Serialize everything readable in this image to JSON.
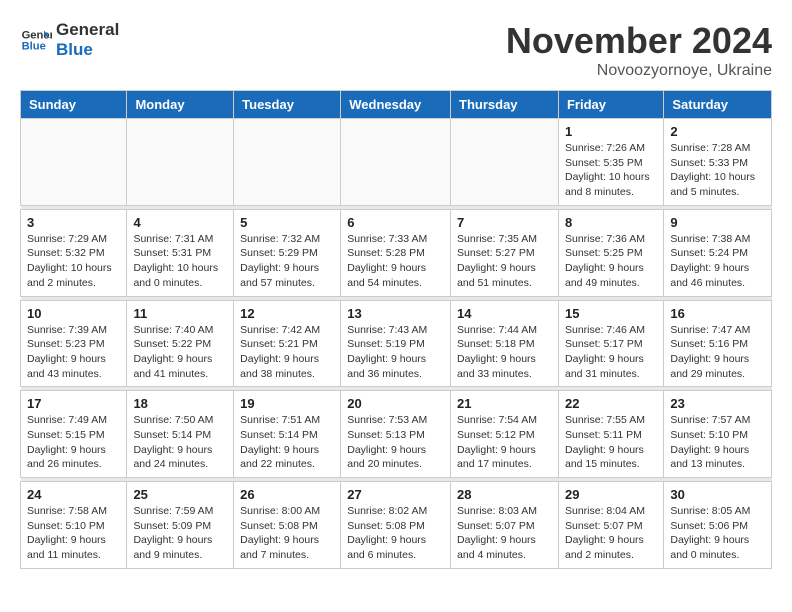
{
  "logo": {
    "line1": "General",
    "line2": "Blue"
  },
  "title": "November 2024",
  "location": "Novoozyornoye, Ukraine",
  "weekdays": [
    "Sunday",
    "Monday",
    "Tuesday",
    "Wednesday",
    "Thursday",
    "Friday",
    "Saturday"
  ],
  "weeks": [
    [
      {
        "day": "",
        "info": ""
      },
      {
        "day": "",
        "info": ""
      },
      {
        "day": "",
        "info": ""
      },
      {
        "day": "",
        "info": ""
      },
      {
        "day": "",
        "info": ""
      },
      {
        "day": "1",
        "info": "Sunrise: 7:26 AM\nSunset: 5:35 PM\nDaylight: 10 hours and 8 minutes."
      },
      {
        "day": "2",
        "info": "Sunrise: 7:28 AM\nSunset: 5:33 PM\nDaylight: 10 hours and 5 minutes."
      }
    ],
    [
      {
        "day": "3",
        "info": "Sunrise: 7:29 AM\nSunset: 5:32 PM\nDaylight: 10 hours and 2 minutes."
      },
      {
        "day": "4",
        "info": "Sunrise: 7:31 AM\nSunset: 5:31 PM\nDaylight: 10 hours and 0 minutes."
      },
      {
        "day": "5",
        "info": "Sunrise: 7:32 AM\nSunset: 5:29 PM\nDaylight: 9 hours and 57 minutes."
      },
      {
        "day": "6",
        "info": "Sunrise: 7:33 AM\nSunset: 5:28 PM\nDaylight: 9 hours and 54 minutes."
      },
      {
        "day": "7",
        "info": "Sunrise: 7:35 AM\nSunset: 5:27 PM\nDaylight: 9 hours and 51 minutes."
      },
      {
        "day": "8",
        "info": "Sunrise: 7:36 AM\nSunset: 5:25 PM\nDaylight: 9 hours and 49 minutes."
      },
      {
        "day": "9",
        "info": "Sunrise: 7:38 AM\nSunset: 5:24 PM\nDaylight: 9 hours and 46 minutes."
      }
    ],
    [
      {
        "day": "10",
        "info": "Sunrise: 7:39 AM\nSunset: 5:23 PM\nDaylight: 9 hours and 43 minutes."
      },
      {
        "day": "11",
        "info": "Sunrise: 7:40 AM\nSunset: 5:22 PM\nDaylight: 9 hours and 41 minutes."
      },
      {
        "day": "12",
        "info": "Sunrise: 7:42 AM\nSunset: 5:21 PM\nDaylight: 9 hours and 38 minutes."
      },
      {
        "day": "13",
        "info": "Sunrise: 7:43 AM\nSunset: 5:19 PM\nDaylight: 9 hours and 36 minutes."
      },
      {
        "day": "14",
        "info": "Sunrise: 7:44 AM\nSunset: 5:18 PM\nDaylight: 9 hours and 33 minutes."
      },
      {
        "day": "15",
        "info": "Sunrise: 7:46 AM\nSunset: 5:17 PM\nDaylight: 9 hours and 31 minutes."
      },
      {
        "day": "16",
        "info": "Sunrise: 7:47 AM\nSunset: 5:16 PM\nDaylight: 9 hours and 29 minutes."
      }
    ],
    [
      {
        "day": "17",
        "info": "Sunrise: 7:49 AM\nSunset: 5:15 PM\nDaylight: 9 hours and 26 minutes."
      },
      {
        "day": "18",
        "info": "Sunrise: 7:50 AM\nSunset: 5:14 PM\nDaylight: 9 hours and 24 minutes."
      },
      {
        "day": "19",
        "info": "Sunrise: 7:51 AM\nSunset: 5:14 PM\nDaylight: 9 hours and 22 minutes."
      },
      {
        "day": "20",
        "info": "Sunrise: 7:53 AM\nSunset: 5:13 PM\nDaylight: 9 hours and 20 minutes."
      },
      {
        "day": "21",
        "info": "Sunrise: 7:54 AM\nSunset: 5:12 PM\nDaylight: 9 hours and 17 minutes."
      },
      {
        "day": "22",
        "info": "Sunrise: 7:55 AM\nSunset: 5:11 PM\nDaylight: 9 hours and 15 minutes."
      },
      {
        "day": "23",
        "info": "Sunrise: 7:57 AM\nSunset: 5:10 PM\nDaylight: 9 hours and 13 minutes."
      }
    ],
    [
      {
        "day": "24",
        "info": "Sunrise: 7:58 AM\nSunset: 5:10 PM\nDaylight: 9 hours and 11 minutes."
      },
      {
        "day": "25",
        "info": "Sunrise: 7:59 AM\nSunset: 5:09 PM\nDaylight: 9 hours and 9 minutes."
      },
      {
        "day": "26",
        "info": "Sunrise: 8:00 AM\nSunset: 5:08 PM\nDaylight: 9 hours and 7 minutes."
      },
      {
        "day": "27",
        "info": "Sunrise: 8:02 AM\nSunset: 5:08 PM\nDaylight: 9 hours and 6 minutes."
      },
      {
        "day": "28",
        "info": "Sunrise: 8:03 AM\nSunset: 5:07 PM\nDaylight: 9 hours and 4 minutes."
      },
      {
        "day": "29",
        "info": "Sunrise: 8:04 AM\nSunset: 5:07 PM\nDaylight: 9 hours and 2 minutes."
      },
      {
        "day": "30",
        "info": "Sunrise: 8:05 AM\nSunset: 5:06 PM\nDaylight: 9 hours and 0 minutes."
      }
    ]
  ]
}
